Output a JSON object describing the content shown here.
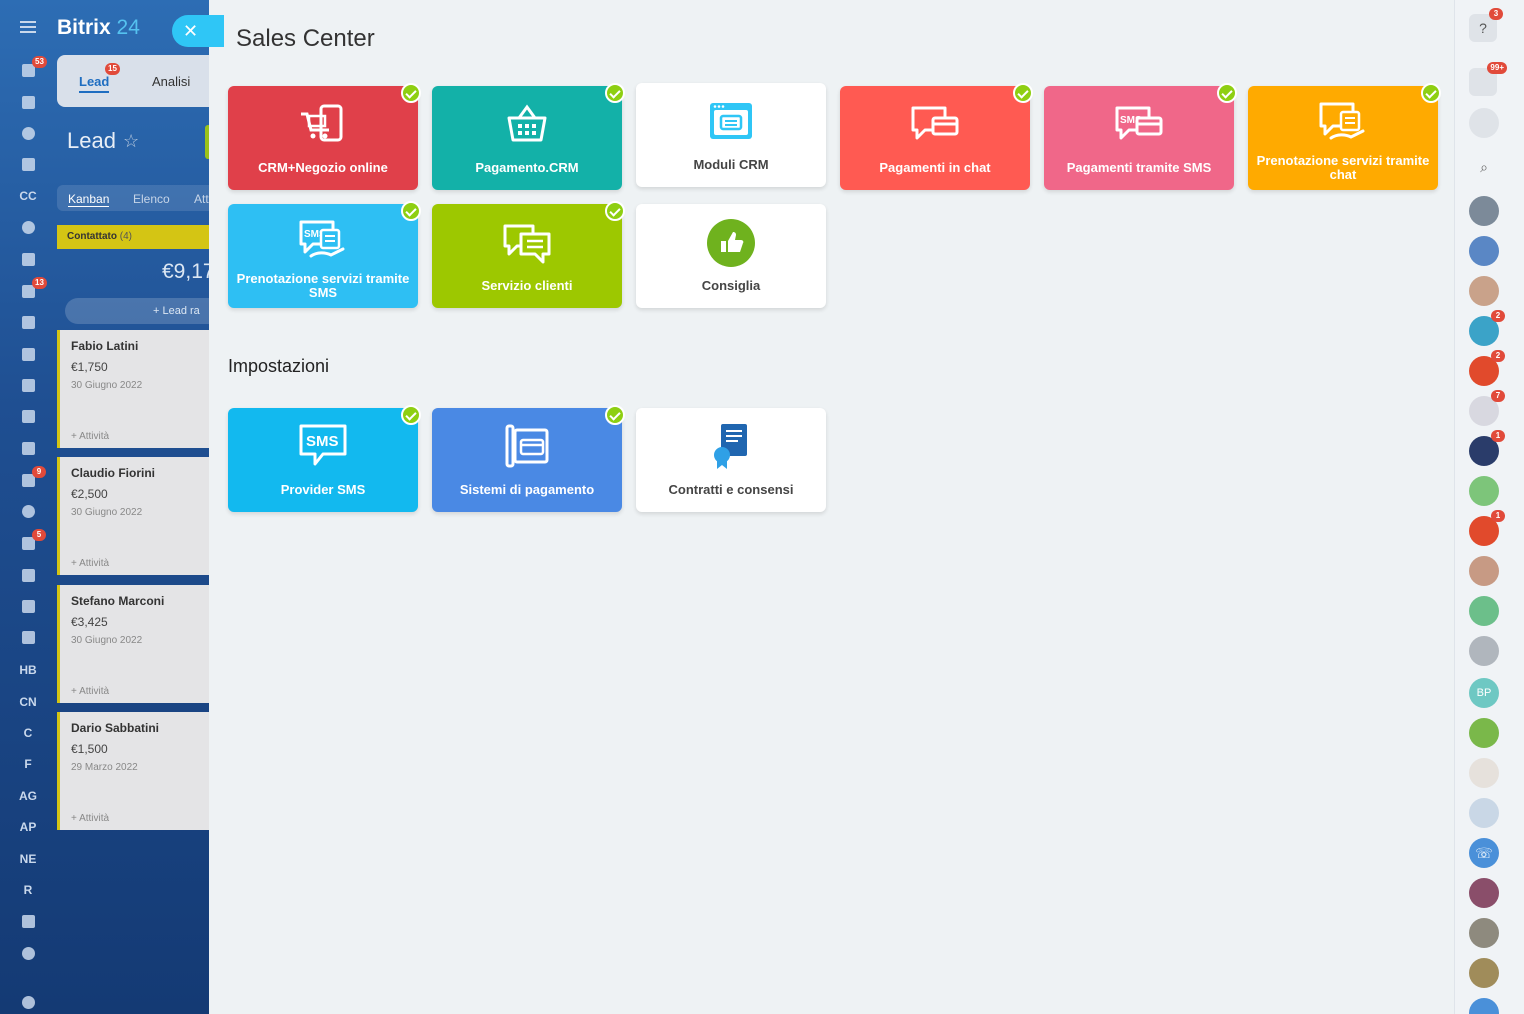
{
  "app": {
    "logo_main": "Bitrix",
    "logo_num": "24",
    "close_glyph": "✕"
  },
  "leftnav": [
    {
      "icon": "filter-icon",
      "badge": "53"
    },
    {
      "icon": "home-icon"
    },
    {
      "icon": "target-icon"
    },
    {
      "icon": "cart-icon"
    },
    {
      "text": "CC"
    },
    {
      "icon": "puzzle-icon"
    },
    {
      "icon": "document-icon"
    },
    {
      "icon": "chat-icon",
      "badge": "13"
    },
    {
      "icon": "calendar-icon"
    },
    {
      "icon": "file-icon"
    },
    {
      "icon": "drive-icon"
    },
    {
      "icon": "mail-icon"
    },
    {
      "icon": "contact-card-icon"
    },
    {
      "icon": "tasks-icon",
      "badge": "9"
    },
    {
      "icon": "group-icon"
    },
    {
      "icon": "robot-icon",
      "badge": "5"
    },
    {
      "icon": "box-icon"
    },
    {
      "icon": "sign-icon"
    },
    {
      "icon": "code-icon"
    },
    {
      "text": "HB"
    },
    {
      "text": "CN"
    },
    {
      "text": "C"
    },
    {
      "text": "F"
    },
    {
      "text": "AG"
    },
    {
      "text": "AP"
    },
    {
      "text": "NE"
    },
    {
      "text": "R"
    },
    {
      "icon": "pen-icon"
    },
    {
      "icon": "check-circle-icon"
    },
    {
      "icon": "help-icon"
    }
  ],
  "crm": {
    "tabs": [
      {
        "label": "Lead",
        "badge": "15"
      },
      {
        "label": "Analisi"
      }
    ],
    "title": "Lead",
    "view_tabs": [
      "Kanban",
      "Elenco",
      "Att"
    ],
    "stage": {
      "name": "Contattato",
      "count": "(4)",
      "sum": "€9,17"
    },
    "quick_add": "+ Lead ra",
    "cards": [
      {
        "name": "Fabio Latini",
        "amount": "€1,750",
        "date": "30 Giugno 2022",
        "activity": "+ Attività"
      },
      {
        "name": "Claudio Fiorini",
        "amount": "€2,500",
        "date": "30 Giugno 2022",
        "activity": "+ Attività"
      },
      {
        "name": "Stefano Marconi",
        "amount": "€3,425",
        "date": "30 Giugno 2022",
        "activity": "+ Attività"
      },
      {
        "name": "Dario Sabbatini",
        "amount": "€1,500",
        "date": "29 Marzo 2022",
        "activity": "+ Attività"
      }
    ]
  },
  "sales_center": {
    "title": "Sales Center",
    "tiles": [
      {
        "label": "CRM+Negozio online",
        "color": "#e0404a",
        "icon": "cart-screen-icon",
        "checked": true
      },
      {
        "label": "Pagamento.CRM",
        "color": "#13b1a8",
        "icon": "basket-icon",
        "checked": true
      },
      {
        "label": "Moduli CRM",
        "color": "#ffffff",
        "icon": "form-window-icon",
        "checked": false
      },
      {
        "label": "Pagamenti in chat",
        "color": "#ff5a52",
        "icon": "chat-card-icon",
        "checked": true
      },
      {
        "label": "Pagamenti tramite SMS",
        "color": "#f06789",
        "icon": "sms-card-icon",
        "checked": true
      },
      {
        "label": "Prenotazione servizi tramite chat",
        "color": "#ffaa00",
        "icon": "chat-booking-icon",
        "checked": true
      },
      {
        "label": "Prenotazione servizi tramite SMS",
        "color": "#2ebff3",
        "icon": "sms-booking-icon",
        "checked": true
      },
      {
        "label": "Servizio clienti",
        "color": "#9dc800",
        "icon": "chat-support-icon",
        "checked": true
      },
      {
        "label": "Consiglia",
        "color": "#ffffff",
        "icon": "thumbs-up-icon",
        "checked": false
      }
    ],
    "settings_title": "Impostazioni",
    "settings_tiles": [
      {
        "label": "Provider SMS",
        "color": "#12b9ef",
        "icon": "sms-bubble-icon",
        "checked": true
      },
      {
        "label": "Sistemi di pagamento",
        "color": "#4a89e4",
        "icon": "payment-systems-icon",
        "checked": true
      },
      {
        "label": "Contratti e consensi",
        "color": "#ffffff",
        "icon": "contract-icon",
        "checked": false
      }
    ]
  },
  "right_bar": [
    {
      "icon": "help-icon",
      "badge": "3"
    },
    {
      "icon": "bell-icon",
      "badge": "99+"
    },
    {
      "icon": "chat-list-icon"
    },
    {
      "icon": "search-icon"
    },
    {
      "icon": "avatar-man-icon"
    },
    {
      "icon": "group-chat-icon"
    },
    {
      "icon": "calendar-icon"
    },
    {
      "icon": "avatar-team-icon",
      "badge": "2"
    },
    {
      "icon": "group-red-icon",
      "badge": "2"
    },
    {
      "icon": "avatar-people-icon",
      "badge": "7"
    },
    {
      "icon": "avatar-photo-icon",
      "badge": "1"
    },
    {
      "icon": "group-green-icon"
    },
    {
      "icon": "group-red-icon",
      "badge": "1"
    },
    {
      "icon": "group-brown-icon"
    },
    {
      "icon": "contact-green-icon"
    },
    {
      "icon": "avatar-woman-icon"
    },
    {
      "text": "BP"
    },
    {
      "icon": "task-green-icon"
    },
    {
      "icon": "avatar-woman2-icon"
    },
    {
      "icon": "avatar-man2-icon"
    },
    {
      "icon": "phone-icon"
    },
    {
      "icon": "avatar-art-icon"
    },
    {
      "icon": "avatar-photo2-icon"
    },
    {
      "icon": "avatar-photo3-icon"
    },
    {
      "icon": "phone-icon"
    }
  ]
}
